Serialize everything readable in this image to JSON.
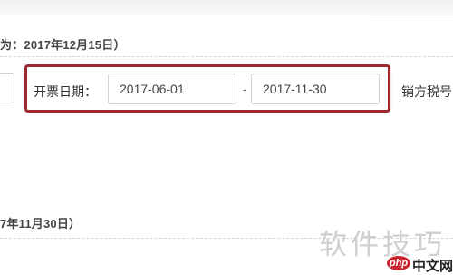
{
  "header_note": "为：2017年12月15日）",
  "filter": {
    "label": "开票日期：",
    "start_value": "2017-06-01",
    "separator": "-",
    "end_value": "2017-11-30",
    "next_label": "销方税号"
  },
  "footer_note": "7年11月30日）",
  "watermark": {
    "text": "软件技巧",
    "badge": "php",
    "site": "中文网"
  },
  "colors": {
    "highlight_border": "#9e2a2e",
    "badge_bg": "#c9252c"
  }
}
